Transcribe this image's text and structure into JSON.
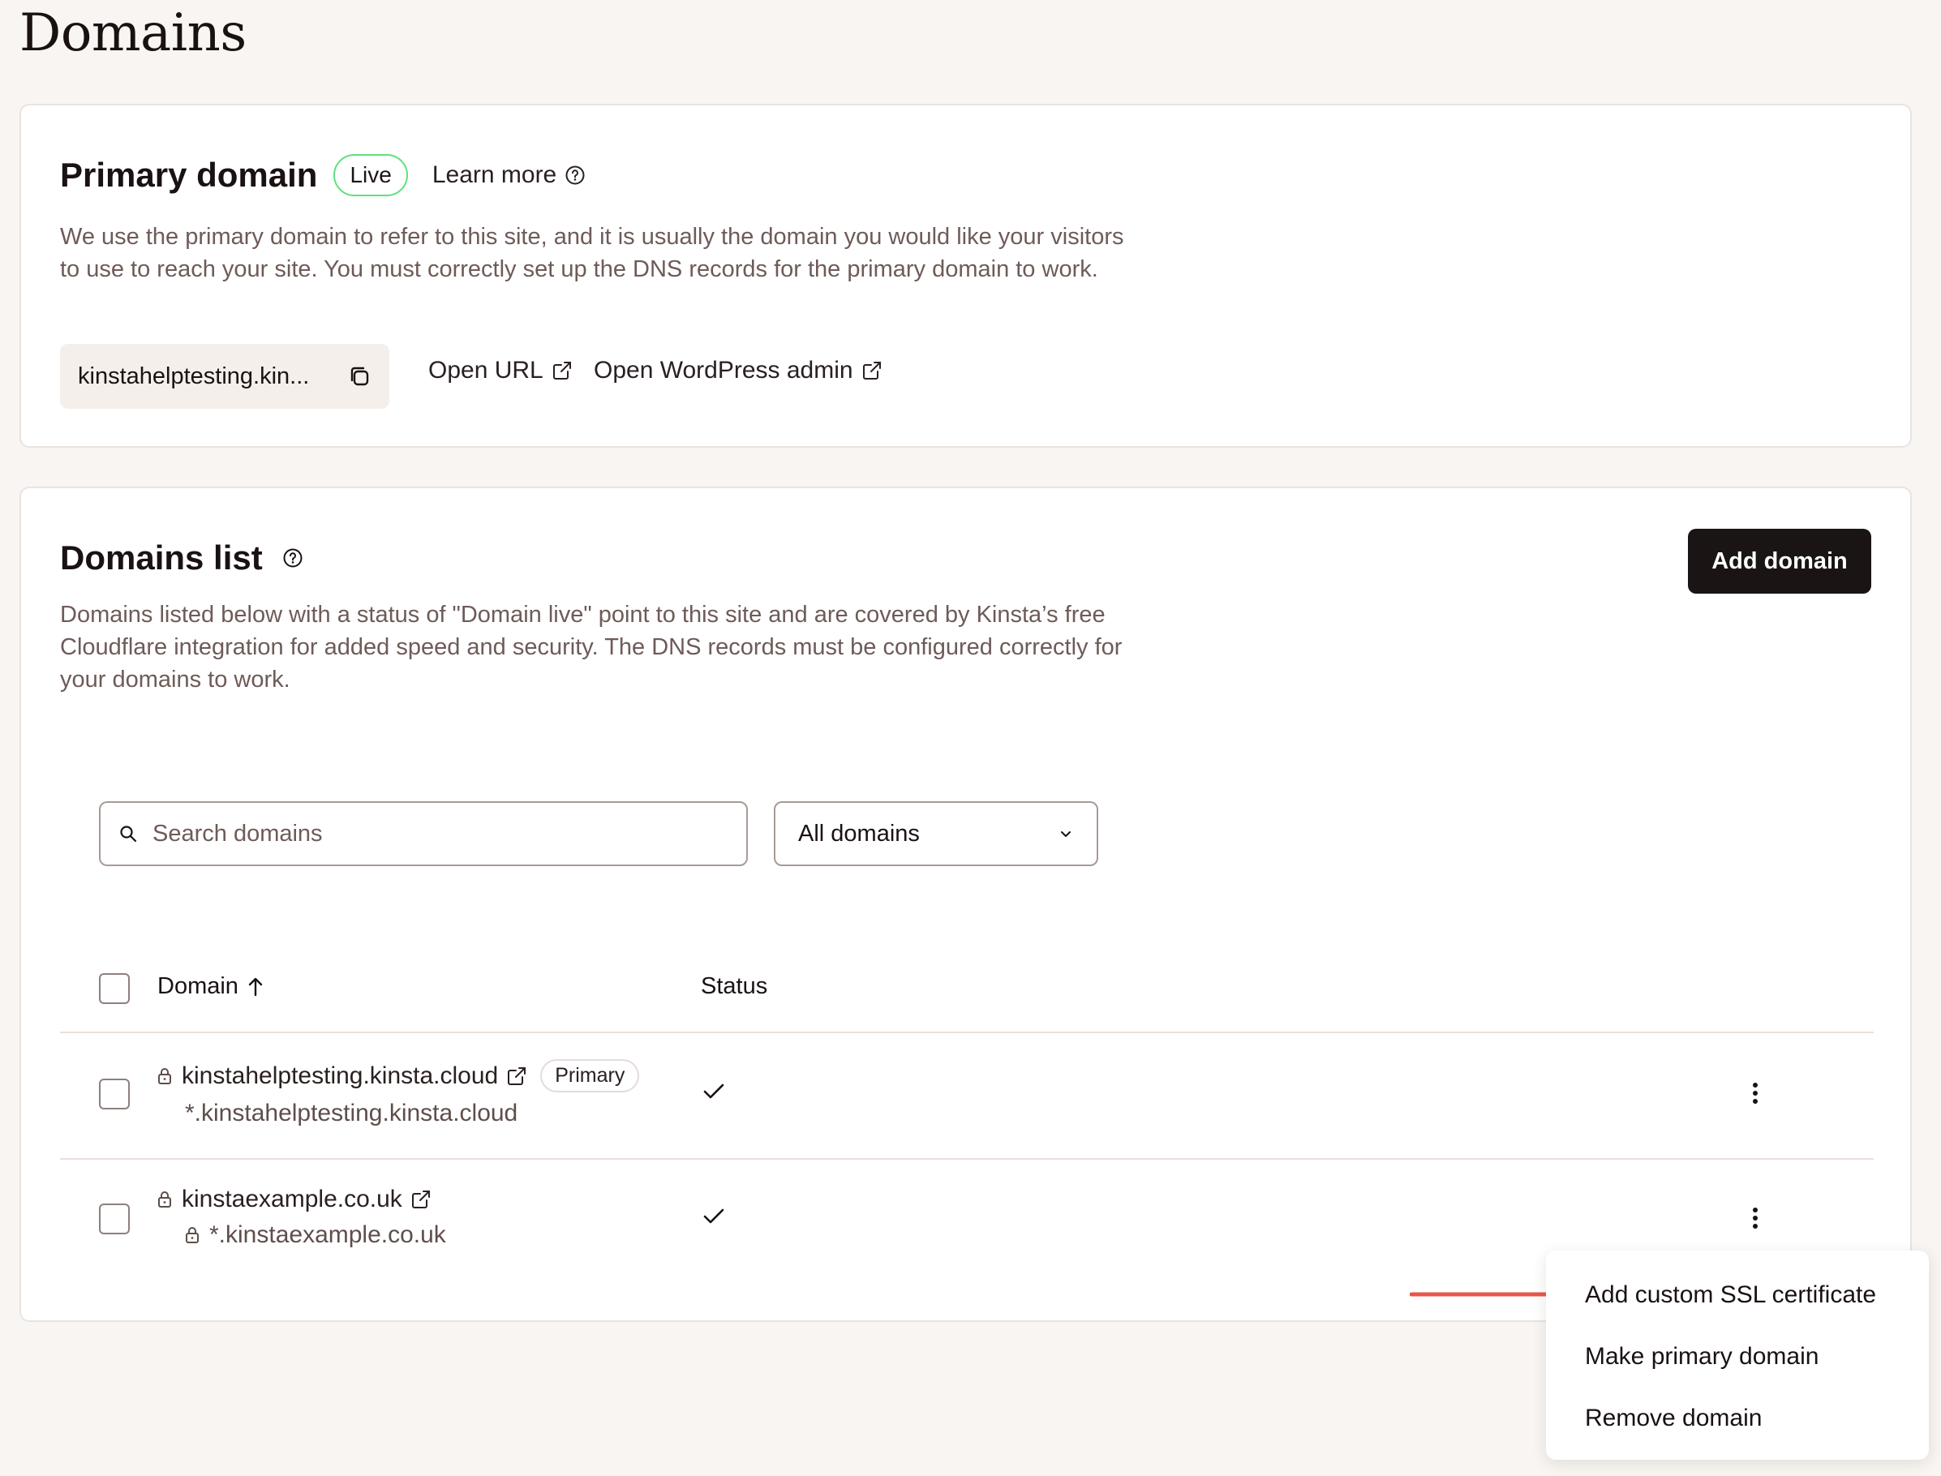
{
  "page": {
    "title": "Domains"
  },
  "primary_domain": {
    "heading": "Primary domain",
    "status_badge": "Live",
    "learn_more": "Learn more",
    "description": "We use the primary domain to refer to this site, and it is usually the domain you would like your visitors to use to reach your site. You must correctly set up the DNS records for the primary domain to work.",
    "url_display": "kinstahelptesting.kin...",
    "open_url": "Open URL",
    "open_wp_admin": "Open WordPress admin"
  },
  "domains_list": {
    "heading": "Domains list",
    "add_button": "Add domain",
    "description": "Domains listed below with a status of \"Domain live\" point to this site and are covered by Kinsta’s free Cloudflare integration for added speed and security. The DNS records must be configured correctly for your domains to work.",
    "search_placeholder": "Search domains",
    "filter_selected": "All domains",
    "columns": {
      "domain": "Domain",
      "status": "Status"
    },
    "rows": [
      {
        "domain": "kinstahelptesting.kinsta.cloud",
        "badge": "Primary",
        "wildcard": "*.kinstahelptesting.kinsta.cloud"
      },
      {
        "domain": "kinstaexample.co.uk",
        "wildcard": "*.kinstaexample.co.uk"
      }
    ]
  },
  "context_menu": {
    "items": [
      "Add custom SSL certificate",
      "Make primary domain",
      "Remove domain"
    ]
  },
  "colors": {
    "accent_dark": "#1a1414",
    "live_green": "#5ee07f",
    "annotation_red": "#e8574a",
    "background": "#f8f5f2"
  }
}
